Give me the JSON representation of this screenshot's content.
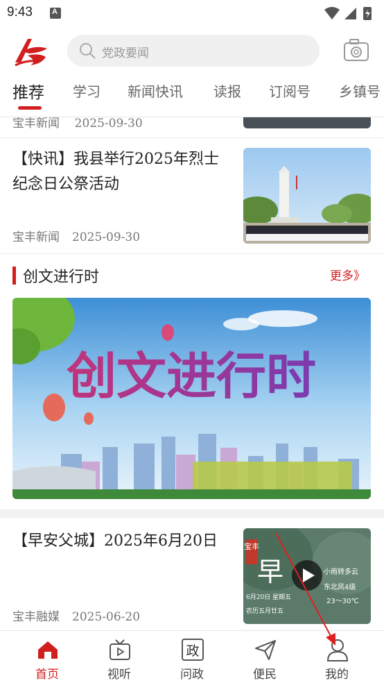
{
  "status_bar": {
    "time": "9:43"
  },
  "search": {
    "placeholder": "党政要闻"
  },
  "tabs": [
    {
      "label": "推荐",
      "active": true
    },
    {
      "label": "学习"
    },
    {
      "label": "新闻快讯"
    },
    {
      "label": "读报"
    },
    {
      "label": "订阅号"
    },
    {
      "label": "乡镇号"
    }
  ],
  "partial_item": {
    "source": "宝丰新闻",
    "date": "2025-09-30"
  },
  "news": [
    {
      "title": "【快讯】我县举行2025年烈士纪念日公祭活动",
      "source": "宝丰新闻",
      "date": "2025-09-30"
    },
    {
      "title": "【早安父城】2025年6月20日",
      "source": "宝丰融媒",
      "date": "2025-06-20"
    }
  ],
  "section": {
    "title": "创文进行时",
    "more": "更多》"
  },
  "banner": {
    "text": "创文进行时"
  },
  "video_thumb": {
    "brand": "宝丰",
    "headline": "早",
    "weather_line1": "小雨转多云",
    "weather_line2": "东北风4级",
    "temp": "23～30℃",
    "date_line": "6月20日 星期五",
    "lunar_line": "农历五月廿五"
  },
  "bottom_nav": [
    {
      "label": "首页",
      "icon": "home-icon",
      "active": true
    },
    {
      "label": "视听",
      "icon": "tv-icon"
    },
    {
      "label": "问政",
      "icon": "politics-icon",
      "glyph": "政"
    },
    {
      "label": "便民",
      "icon": "paper-plane-icon"
    },
    {
      "label": "我的",
      "icon": "person-icon"
    }
  ],
  "colors": {
    "accent": "#d11f1f"
  }
}
